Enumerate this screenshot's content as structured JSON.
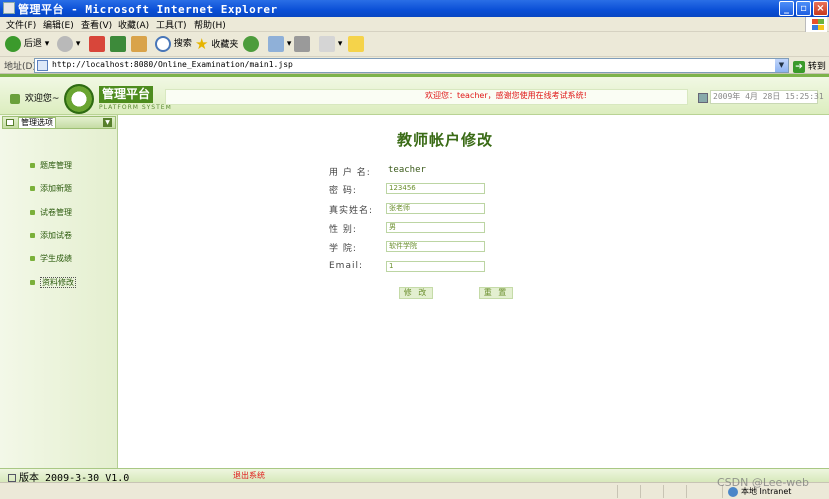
{
  "window": {
    "title": "管理平台 - Microsoft Internet Explorer"
  },
  "menu": [
    "文件(F)",
    "编辑(E)",
    "查看(V)",
    "收藏(A)",
    "工具(T)",
    "帮助(H)"
  ],
  "toolbar": {
    "back_label": "后退",
    "search_label": "搜索",
    "favorites_label": "收藏夹"
  },
  "address": {
    "label": "地址(D)",
    "url": "http://localhost:8080/Online_Examination/main1.jsp",
    "go_label": "转到"
  },
  "header": {
    "welcome": "欢迎您~",
    "logo_text": "管理平台",
    "logo_sub": "PLATFORM SYSTEM",
    "notice": "欢迎您：teacher，感谢您使用在线考试系统!",
    "datetime": "2009年 4月 28日 15:25:31"
  },
  "sidebar": {
    "title": "管理选项",
    "items": [
      "题库管理",
      "添加新题",
      "试卷管理",
      "添加试卷",
      "学生成绩",
      "资料修改"
    ]
  },
  "form": {
    "title": "教师帐户修改",
    "username_label": "用 户 名:",
    "username_value": "teacher",
    "password_label": "密    码:",
    "password_value": "123456",
    "realname_label": "真实姓名:",
    "realname_value": "张老师",
    "gender_label": "性    别:",
    "gender_value": "男",
    "college_label": "学    院:",
    "college_value": "软件学院",
    "email_label": "Email:",
    "email_value": "1",
    "submit_label": "修 改",
    "reset_label": "重 置"
  },
  "footer": {
    "version": "版本 2009-3-30 V1.0",
    "logout": "退出系统"
  },
  "status": {
    "zone": "本地 Intranet"
  },
  "watermark": "CSDN @Lee-web"
}
